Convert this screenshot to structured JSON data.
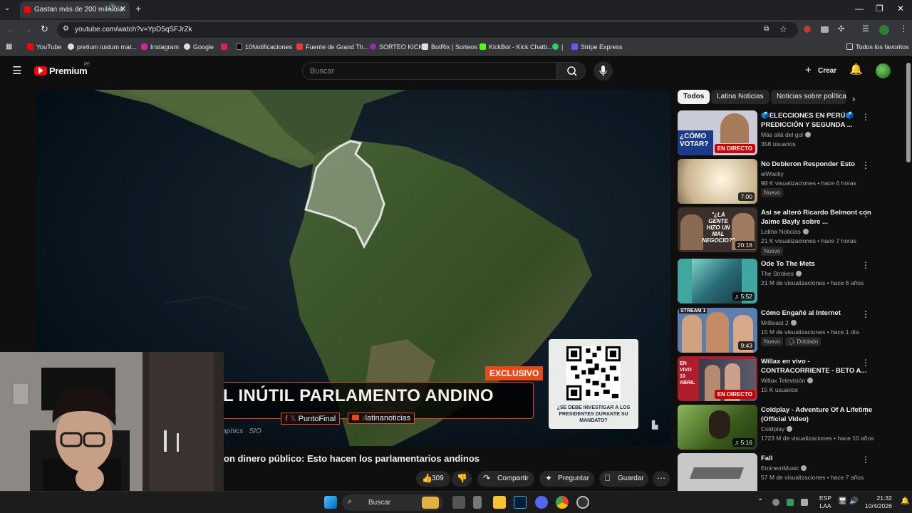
{
  "browser": {
    "tab_title": "Gastan más de 200 mil dóla",
    "url": "youtube.com/watch?v=YpD5qSFJrZk",
    "bookmarks": [
      "YouTube",
      "pretium iustum mat...",
      "Instagram",
      "Google",
      "10Notificaciones",
      "Fuente de Grand Th...",
      "SORTEO KICK",
      "BotRix | Sorteos",
      "KickBot - Kick Chatb...",
      "|",
      "Stripe Express"
    ],
    "all_bookmarks": "Todos los favoritos"
  },
  "yt": {
    "logo": "Premium",
    "region": "PE",
    "search_placeholder": "Buscar",
    "create_label": "Crear"
  },
  "video": {
    "banner_title": "L INÚTIL PARLAMENTO ANDINO",
    "exclusive": "EXCLUSIVO",
    "social_1": "PuntoFinal",
    "social_2": "latinanoticias",
    "credit": "raphics   SIO",
    "qr_caption": "¿SE DEBE INVESTIGAR A LOS PRESIDENTES DURANTE SU MANDATO?",
    "title": "on dinero público: Esto hacen los parlamentarios andinos",
    "likes": "309",
    "share": "Compartir",
    "ask": "Preguntar",
    "save": "Guardar"
  },
  "chips": [
    "Todos",
    "Latina Noticias",
    "Noticias sobre política"
  ],
  "recommendations": [
    {
      "title": "🗳️ELECCIONES EN PERÚ🗳️ PREDICCIÓN Y SEGUNDA ...",
      "channel": "Más allá del gol",
      "meta": "358 usuarios",
      "duration": "",
      "live": "EN DIRECTO",
      "badges": [],
      "thumb_text": "¿CÓMO VOTAR?",
      "thumb_color": "#c9ccd6"
    },
    {
      "title": "No Debieron Responder Esto",
      "channel": "elWacky",
      "meta": "98 K visualizaciones • hace 6 horas",
      "duration": "7:00",
      "live": "",
      "badges": [
        "Nuevo"
      ],
      "thumb_text": "",
      "thumb_color": "#d9c9a8"
    },
    {
      "title": "Así se alteró Ricardo Belmont con Jaime Bayly sobre ...",
      "channel": "Latina Noticias",
      "meta": "21 K visualizaciones • hace 7 horas",
      "duration": "20:18",
      "live": "",
      "badges": [
        "Nuevo"
      ],
      "thumb_text": "\"¿LA GENTE HIZO UN MAL NEGOCIO?\"",
      "thumb_color": "#3a2f2a"
    },
    {
      "title": "Ode To The Mets",
      "channel": "The Strokes",
      "meta": "21 M de visualizaciones • hace 6 años",
      "duration": "5:52",
      "live": "",
      "badges": [],
      "thumb_text": "",
      "thumb_color": "#3fa6a0"
    },
    {
      "title": "Cómo Engañé al Internet",
      "channel": "MrBeast 2",
      "meta": "15 M de visualizaciones • hace 1 día",
      "duration": "9:43",
      "live": "",
      "badges": [
        "Nuevo",
        "Doblado"
      ],
      "thumb_text": "STREAM 1",
      "thumb_color": "#5a7fb0"
    },
    {
      "title": "Willax en vivo - CONTRACORRIENTE - BETO A...",
      "channel": "Willax Televisión",
      "meta": "15 K usuarios",
      "duration": "",
      "live": "EN DIRECTO",
      "badges": [],
      "thumb_text": "EN VIVO 10 ABRIL",
      "thumb_color": "#b01c2a"
    },
    {
      "title": "Coldplay - Adventure Of A Lifetime (Official Video)",
      "channel": "Coldplay",
      "meta": "1723 M de visualizaciones • hace 10 años",
      "duration": "5:16",
      "live": "",
      "badges": [],
      "thumb_text": "",
      "thumb_color": "#4a6a2a"
    },
    {
      "title": "Fall",
      "channel": "EminemMusic",
      "meta": "57 M de visualizaciones • hace 7 años",
      "duration": "",
      "live": "",
      "badges": [],
      "thumb_text": "",
      "thumb_color": "#c8c8c8"
    }
  ],
  "taskbar": {
    "search": "Buscar",
    "lang": "ESP",
    "layout": "LAA",
    "time": "21:32",
    "date": "10/4/2026"
  }
}
